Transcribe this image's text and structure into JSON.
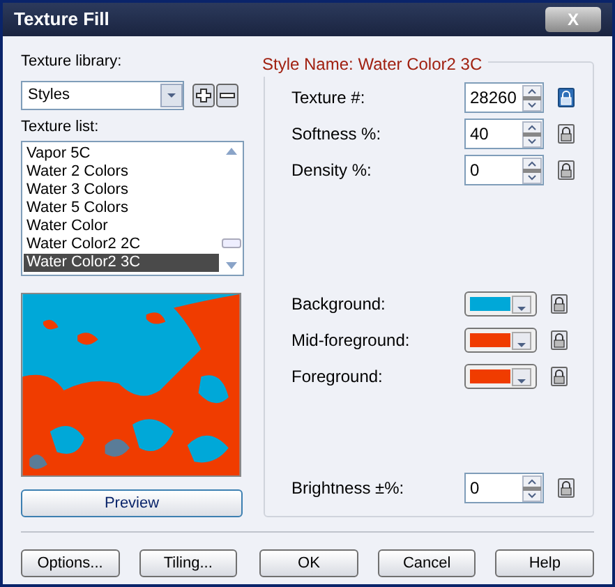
{
  "window": {
    "title": "Texture Fill",
    "close": "X"
  },
  "library": {
    "label": "Texture library:",
    "value": "Styles"
  },
  "list": {
    "label": "Texture list:",
    "items": [
      {
        "label": "Vapor 5C",
        "selected": false
      },
      {
        "label": "Water 2 Colors",
        "selected": false
      },
      {
        "label": "Water 3 Colors",
        "selected": false
      },
      {
        "label": "Water 5 Colors",
        "selected": false
      },
      {
        "label": "Water Color",
        "selected": false
      },
      {
        "label": "Water Color2 2C",
        "selected": false
      },
      {
        "label": "Water Color2 3C",
        "selected": true
      }
    ]
  },
  "preview_button": "Preview",
  "group_title": "Style Name: Water Color2 3C",
  "fields": [
    {
      "kind": "spin",
      "label": "Texture #:",
      "value": "28260",
      "active": true
    },
    {
      "kind": "spin",
      "label": "Softness %:",
      "value": "40",
      "active": false
    },
    {
      "kind": "spin",
      "label": "Density %:",
      "value": "0",
      "active": false
    },
    {
      "kind": "gap"
    },
    {
      "kind": "color",
      "label": "Background:",
      "color": "#00a8d8",
      "active": false
    },
    {
      "kind": "color",
      "label": "Mid-foreground:",
      "color": "#f03c00",
      "active": false
    },
    {
      "kind": "color",
      "label": "Foreground:",
      "color": "#f03c00",
      "active": false
    },
    {
      "kind": "gap"
    },
    {
      "kind": "spin",
      "label": "Brightness ±%:",
      "value": "0",
      "active": false
    }
  ],
  "buttons": [
    "Options...",
    "Tiling...",
    "OK",
    "Cancel",
    "Help"
  ]
}
